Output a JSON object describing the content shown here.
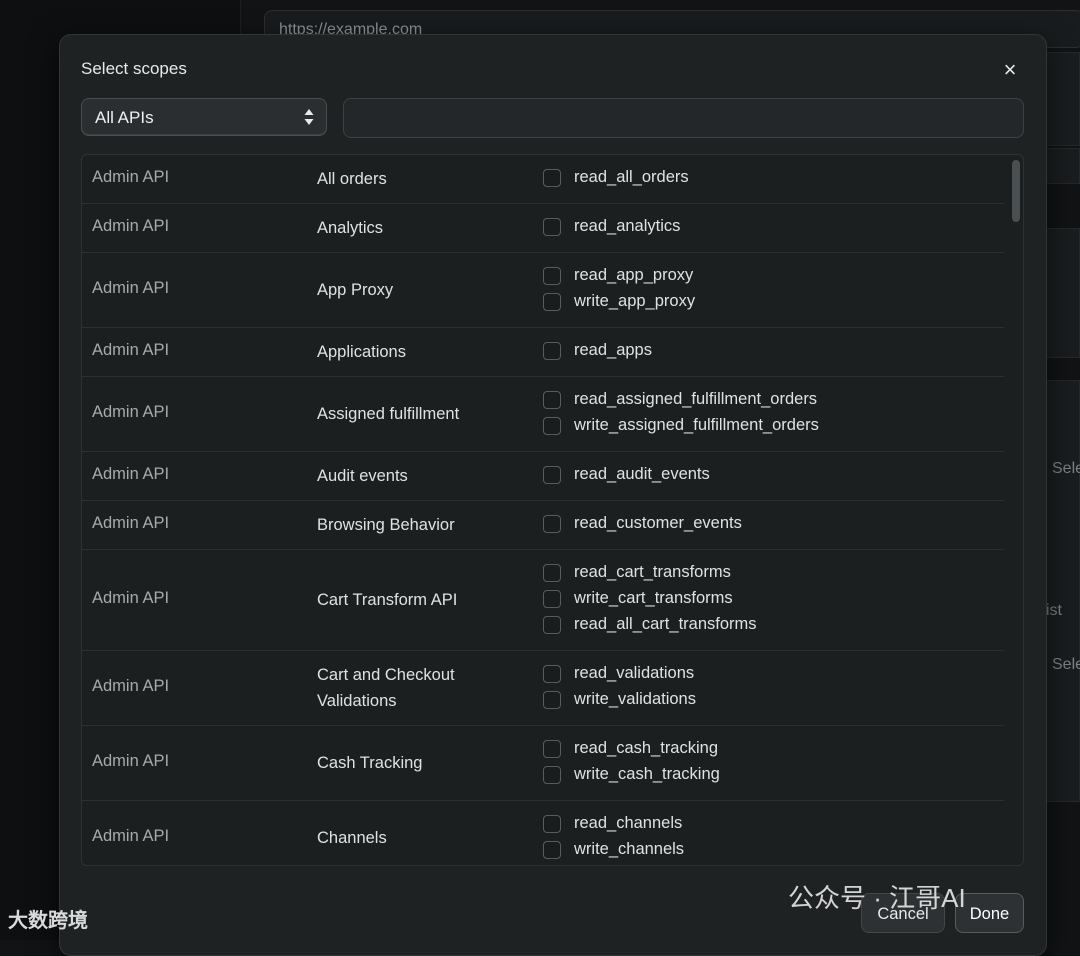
{
  "background": {
    "url_value": "https://example.com",
    "peek_labels": [
      "Sele",
      "ist",
      "Sele"
    ]
  },
  "modal": {
    "title": "Select scopes",
    "close_glyph": "×",
    "filter": {
      "selected": "All APIs",
      "options": [
        "All APIs"
      ]
    },
    "search": {
      "value": "",
      "placeholder": ""
    },
    "rows": [
      {
        "api": "Admin API",
        "name": "All orders",
        "scopes": [
          "read_all_orders"
        ]
      },
      {
        "api": "Admin API",
        "name": "Analytics",
        "scopes": [
          "read_analytics"
        ]
      },
      {
        "api": "Admin API",
        "name": "App Proxy",
        "scopes": [
          "read_app_proxy",
          "write_app_proxy"
        ]
      },
      {
        "api": "Admin API",
        "name": "Applications",
        "scopes": [
          "read_apps"
        ]
      },
      {
        "api": "Admin API",
        "name": "Assigned fulfillment",
        "scopes": [
          "read_assigned_fulfillment_orders",
          "write_assigned_fulfillment_orders"
        ]
      },
      {
        "api": "Admin API",
        "name": "Audit events",
        "scopes": [
          "read_audit_events"
        ]
      },
      {
        "api": "Admin API",
        "name": "Browsing Behavior",
        "scopes": [
          "read_customer_events"
        ]
      },
      {
        "api": "Admin API",
        "name": "Cart Transform API",
        "scopes": [
          "read_cart_transforms",
          "write_cart_transforms",
          "read_all_cart_transforms"
        ]
      },
      {
        "api": "Admin API",
        "name": "Cart and Checkout Validations",
        "scopes": [
          "read_validations",
          "write_validations"
        ]
      },
      {
        "api": "Admin API",
        "name": "Cash Tracking",
        "scopes": [
          "read_cash_tracking",
          "write_cash_tracking"
        ]
      },
      {
        "api": "Admin API",
        "name": "Channels",
        "scopes": [
          "read_channels",
          "write_channels"
        ]
      }
    ],
    "cancel_label": "Cancel",
    "done_label": "Done"
  },
  "watermarks": {
    "left": "大数跨境",
    "right": "公众号 · 江哥AI"
  },
  "colors": {
    "modal_bg": "#1f2223",
    "page_bg": "#111314",
    "text_primary": "#dfe2e3",
    "text_muted": "#a5aaad"
  }
}
